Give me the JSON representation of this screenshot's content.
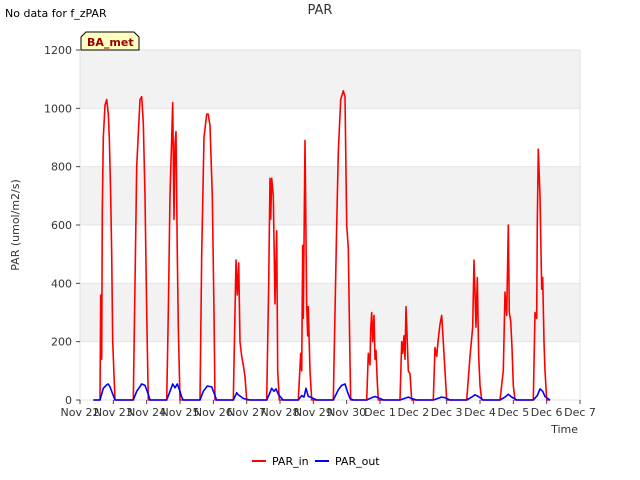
{
  "no_data_text": "No data for f_zPAR",
  "chart_data": {
    "type": "line",
    "title": "PAR",
    "xlabel": "Time",
    "ylabel": "PAR (umol/m2/s)",
    "site_label": "BA_met",
    "ylim": [
      0,
      1200
    ],
    "yticks": [
      0,
      200,
      400,
      600,
      800,
      1000,
      1200
    ],
    "xlim": [
      0,
      15
    ],
    "xtick_labels": [
      "Nov 22",
      "Nov 23",
      "Nov 24",
      "Nov 25",
      "Nov 26",
      "Nov 27",
      "Nov 28",
      "Nov 29",
      "Nov 30",
      "Dec 1",
      "Dec 2",
      "Dec 3",
      "Dec 4",
      "Dec 5",
      "Dec 6",
      "Dec 7"
    ],
    "grid": true,
    "legend_position": "bottom-center",
    "series": [
      {
        "name": "PAR_in",
        "color": "#ff0000",
        "x": [
          0.4,
          0.6,
          0.62,
          0.65,
          0.67,
          0.7,
          0.75,
          0.8,
          0.85,
          0.88,
          0.92,
          0.95,
          0.98,
          1.05,
          1.1,
          1.12,
          1.2,
          1.3,
          1.6,
          1.65,
          1.7,
          1.8,
          1.85,
          1.9,
          1.95,
          2.0,
          2.05,
          2.1,
          2.12,
          2.2,
          2.6,
          2.65,
          2.7,
          2.75,
          2.78,
          2.82,
          2.85,
          2.88,
          2.92,
          2.95,
          3.0,
          3.02,
          3.1,
          3.6,
          3.65,
          3.72,
          3.8,
          3.85,
          3.9,
          3.97,
          4.02,
          4.05,
          4.1,
          4.6,
          4.68,
          4.72,
          4.76,
          4.8,
          4.85,
          4.9,
          4.95,
          5.0,
          5.05,
          5.1,
          5.6,
          5.66,
          5.7,
          5.72,
          5.75,
          5.8,
          5.85,
          5.9,
          5.93,
          5.98,
          6.02,
          6.05,
          6.1,
          6.55,
          6.62,
          6.65,
          6.68,
          6.7,
          6.75,
          6.8,
          6.83,
          6.85,
          6.9,
          6.95,
          7.0,
          7.1,
          7.6,
          7.7,
          7.75,
          7.82,
          7.9,
          7.95,
          8.0,
          8.05,
          8.1,
          8.12,
          8.2,
          8.6,
          8.65,
          8.7,
          8.72,
          8.75,
          8.78,
          8.82,
          8.85,
          8.88,
          8.92,
          8.95,
          9.0,
          9.1,
          9.6,
          9.65,
          9.68,
          9.72,
          9.75,
          9.78,
          9.82,
          9.85,
          9.9,
          9.95,
          10.0,
          10.1,
          10.6,
          10.65,
          10.7,
          10.75,
          10.8,
          10.85,
          10.9,
          11.0,
          11.05,
          11.1,
          11.6,
          11.7,
          11.78,
          11.82,
          11.88,
          11.92,
          11.96,
          12.0,
          12.05,
          12.1,
          12.6,
          12.7,
          12.75,
          12.8,
          12.85,
          12.88,
          12.92,
          12.96,
          13.0,
          13.05,
          13.1,
          13.6,
          13.65,
          13.7,
          13.72,
          13.75,
          13.8,
          13.85,
          13.88,
          13.92,
          13.95,
          14.0,
          14.05,
          14.1
        ],
        "values": [
          0,
          0,
          360,
          140,
          650,
          900,
          1010,
          1030,
          980,
          900,
          700,
          500,
          200,
          0,
          0,
          0,
          0,
          0,
          0,
          400,
          800,
          1030,
          1040,
          950,
          700,
          300,
          0,
          0,
          0,
          0,
          0,
          300,
          700,
          900,
          1020,
          620,
          880,
          920,
          500,
          250,
          0,
          0,
          0,
          0,
          500,
          900,
          980,
          980,
          940,
          700,
          300,
          0,
          0,
          0,
          480,
          360,
          470,
          200,
          150,
          120,
          80,
          0,
          0,
          0,
          0,
          400,
          760,
          620,
          760,
          700,
          330,
          580,
          100,
          0,
          0,
          0,
          0,
          0,
          160,
          100,
          530,
          280,
          890,
          320,
          220,
          320,
          100,
          0,
          0,
          0,
          0,
          600,
          850,
          1030,
          1060,
          1040,
          600,
          520,
          130,
          0,
          0,
          0,
          160,
          120,
          240,
          300,
          200,
          290,
          140,
          170,
          60,
          0,
          0,
          0,
          0,
          200,
          160,
          220,
          140,
          320,
          200,
          100,
          90,
          0,
          0,
          0,
          0,
          180,
          150,
          210,
          260,
          290,
          200,
          0,
          0,
          0,
          0,
          150,
          250,
          480,
          250,
          420,
          150,
          50,
          0,
          0,
          0,
          100,
          370,
          290,
          600,
          300,
          270,
          180,
          50,
          0,
          0,
          0,
          300,
          280,
          610,
          860,
          700,
          380,
          420,
          200,
          100,
          0,
          0,
          0
        ]
      },
      {
        "name": "PAR_out",
        "color": "#0000ff",
        "x": [
          0.4,
          0.6,
          0.7,
          0.8,
          0.85,
          0.9,
          1.0,
          1.05,
          1.1,
          1.6,
          1.7,
          1.85,
          1.95,
          2.05,
          2.1,
          2.6,
          2.7,
          2.78,
          2.85,
          2.92,
          3.0,
          3.05,
          3.1,
          3.6,
          3.7,
          3.82,
          3.95,
          4.05,
          4.1,
          4.6,
          4.7,
          4.75,
          4.82,
          4.9,
          5.1,
          5.6,
          5.68,
          5.75,
          5.82,
          5.88,
          5.95,
          6.05,
          6.1,
          6.55,
          6.65,
          6.72,
          6.78,
          6.85,
          6.92,
          7.0,
          7.1,
          7.6,
          7.75,
          7.85,
          7.95,
          8.02,
          8.1,
          8.2,
          8.6,
          8.75,
          8.85,
          8.95,
          9.1,
          9.6,
          9.75,
          9.85,
          9.95,
          10.1,
          10.6,
          10.75,
          10.85,
          10.95,
          11.1,
          11.6,
          11.75,
          11.85,
          11.95,
          12.1,
          12.6,
          12.75,
          12.85,
          12.95,
          13.1,
          13.6,
          13.72,
          13.8,
          13.88,
          13.95,
          14.1
        ],
        "values": [
          0,
          0,
          40,
          52,
          55,
          45,
          15,
          0,
          0,
          0,
          30,
          55,
          50,
          20,
          0,
          0,
          30,
          55,
          42,
          55,
          30,
          10,
          0,
          0,
          30,
          48,
          45,
          15,
          0,
          0,
          25,
          18,
          12,
          5,
          0,
          0,
          20,
          40,
          30,
          38,
          20,
          5,
          0,
          0,
          15,
          10,
          40,
          12,
          10,
          5,
          0,
          0,
          35,
          50,
          55,
          30,
          5,
          0,
          0,
          8,
          12,
          8,
          0,
          0,
          6,
          10,
          5,
          0,
          0,
          6,
          10,
          8,
          0,
          0,
          10,
          18,
          12,
          0,
          0,
          10,
          20,
          10,
          0,
          0,
          15,
          38,
          30,
          12,
          0
        ]
      }
    ]
  }
}
